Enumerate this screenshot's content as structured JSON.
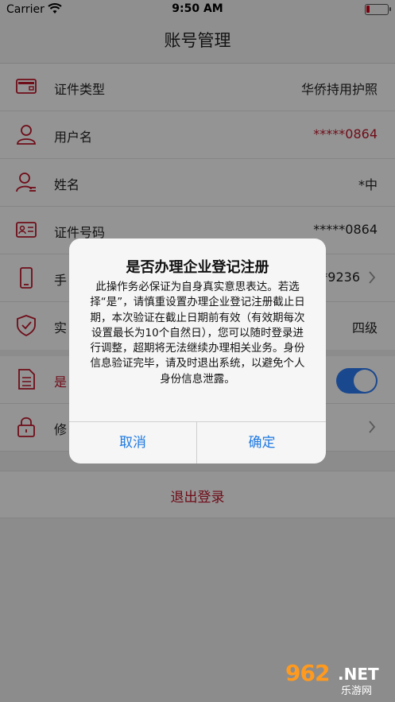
{
  "status_bar": {
    "carrier": "Carrier",
    "time": "9:50 AM"
  },
  "nav": {
    "title": "账号管理"
  },
  "rows": [
    {
      "label": "证件类型",
      "value": "华侨持用护照",
      "icon": "id-card-icon"
    },
    {
      "label": "用户名",
      "value": "*****0864",
      "icon": "user-icon"
    },
    {
      "label": "姓名",
      "value": "*中",
      "icon": "user-name-icon"
    },
    {
      "label": "证件号码",
      "value": "*****0864",
      "icon": "id-number-icon"
    },
    {
      "label": "手",
      "value": "*9236",
      "icon": "phone-icon"
    },
    {
      "label": "实",
      "value": "四级",
      "icon": "shield-icon"
    },
    {
      "label": "是",
      "value": "是",
      "icon": "document-icon"
    },
    {
      "label": "修",
      "value": "",
      "icon": "lock-icon"
    }
  ],
  "logout": {
    "label": "退出登录"
  },
  "dialog": {
    "title": "是否办理企业登记注册",
    "message": "此操作务必保证为自身真实意思表达。若选择“是”，请慎重设置办理企业登记注册截止日期，本次验证在截止日期前有效（有效期每次设置最长为10个自然日），您可以随时登录进行调整，超期将无法继续办理相关业务。身份信息验证完毕，请及时退出系统，以避免个人身份信息泄露。",
    "cancel_label": "取消",
    "confirm_label": "确定"
  },
  "watermark": {
    "number": "962",
    "net": ".NET",
    "site": "乐游网"
  },
  "colors": {
    "accent_red": "#c0172b",
    "link_blue": "#1f7ae0",
    "toggle_blue": "#2e7cf6"
  }
}
